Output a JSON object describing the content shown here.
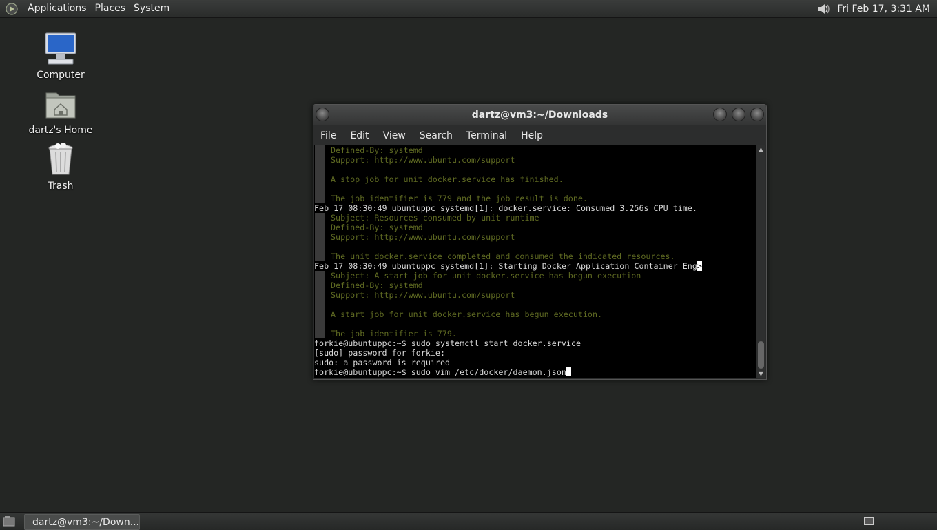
{
  "top_panel": {
    "menus": [
      "Applications",
      "Places",
      "System"
    ],
    "clock": "Fri Feb 17,  3:31 AM"
  },
  "desktop": {
    "icons": [
      {
        "label": "Computer",
        "icon": "computer-icon"
      },
      {
        "label": "dartz's Home",
        "icon": "home-folder-icon"
      },
      {
        "label": "Trash",
        "icon": "trash-icon"
      }
    ]
  },
  "terminal": {
    "title": "dartz@vm3:~/Downloads",
    "menus": [
      "File",
      "Edit",
      "View",
      "Search",
      "Terminal",
      "Help"
    ],
    "lines": [
      "Defined-By: systemd",
      "Support: http://www.ubuntu.com/support",
      "",
      "A stop job for unit docker.service has finished.",
      "",
      "The job identifier is 779 and the job result is done.",
      "Feb 17 08:30:49 ubuntuppc systemd[1]: docker.service: Consumed 3.256s CPU time.",
      "Subject: Resources consumed by unit runtime",
      "Defined-By: systemd",
      "Support: http://www.ubuntu.com/support",
      "",
      "The unit docker.service completed and consumed the indicated resources.",
      "Feb 17 08:30:49 ubuntuppc systemd[1]: Starting Docker Application Container Eng",
      "Subject: A start job for unit docker.service has begun execution",
      "Defined-By: systemd",
      "Support: http://www.ubuntu.com/support",
      "",
      "A start job for unit docker.service has begun execution.",
      "",
      "The job identifier is 779.",
      "forkie@ubuntuppc:~$ sudo systemctl start docker.service",
      "[sudo] password for forkie:",
      "sudo: a password is required",
      "forkie@ubuntuppc:~$ sudo vim /etc/docker/daemon.json"
    ],
    "line_styles": [
      "sub",
      "sub",
      "sub",
      "sub",
      "sub",
      "sub",
      "main",
      "sub",
      "sub",
      "sub",
      "sub",
      "sub",
      "main-trunc",
      "sub",
      "sub",
      "sub",
      "sub",
      "sub",
      "sub",
      "sub",
      "main",
      "main",
      "main",
      "main-cursor"
    ],
    "truncation_marker": ">"
  },
  "bottom_panel": {
    "task_label": "dartz@vm3:~/Down..."
  }
}
